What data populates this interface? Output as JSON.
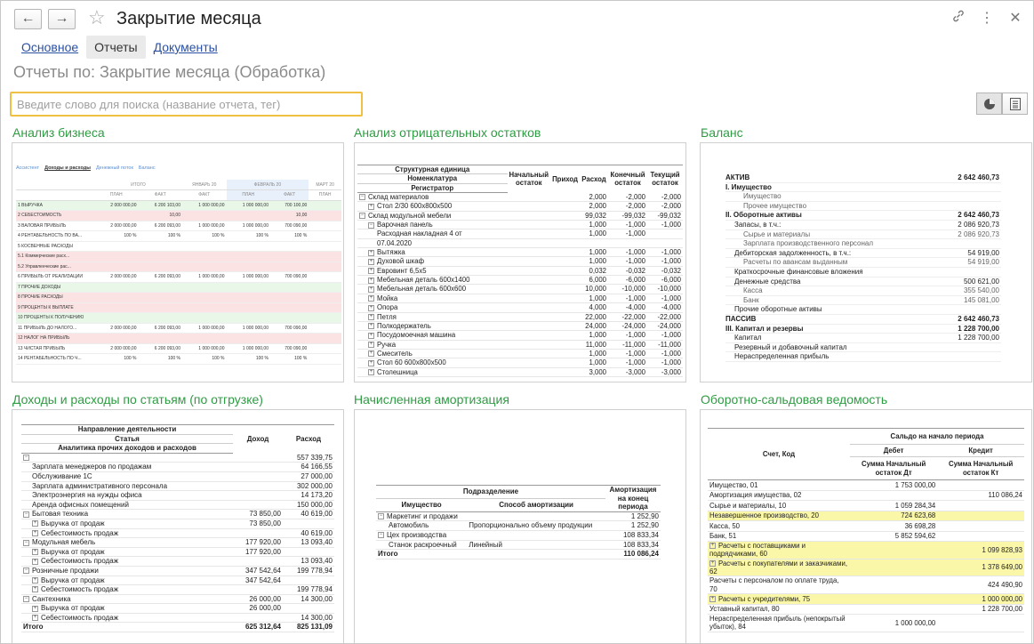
{
  "window": {
    "title": "Закрытие месяца",
    "back_glyph": "←",
    "forward_glyph": "→"
  },
  "tabs": [
    {
      "label": "Основное"
    },
    {
      "label": "Отчеты"
    },
    {
      "label": "Документы"
    }
  ],
  "page_title": "Отчеты по: Закрытие месяца (Обработка)",
  "search": {
    "placeholder": "Введите слово для поиска (название отчета, тег)"
  },
  "cards": [
    {
      "title": "Анализ бизнеса"
    },
    {
      "title": "Анализ отрицательных остатков"
    },
    {
      "title": "Баланс"
    },
    {
      "title": "Доходы и расходы по статьям (по отгрузке)"
    },
    {
      "title": "Начисленная амортизация"
    },
    {
      "title": "Оборотно-сальдовая ведомость"
    }
  ],
  "business": {
    "nav": [
      "Ассистент",
      "Доходы и расходы",
      "Денежный поток",
      "Баланс"
    ],
    "header_periods": [
      "ИТОГО",
      "ЯНВАРЬ 20",
      "ФЕВРАЛЬ 20",
      "МАРТ 20"
    ],
    "header_cols": [
      "ПЛАН",
      "ФАКТ",
      "ФАКТ",
      "ПЛАН",
      "ФАКТ",
      "ПЛАН"
    ],
    "rows": [
      {
        "label": "1  ВЫРУЧКА",
        "vals": [
          "2 000 000,00",
          "6 200 103,00",
          "1 000 000,00",
          "1 000 000,00",
          "700 100,00",
          ""
        ],
        "style": "grn"
      },
      {
        "label": "2  СЕБЕСТОИМОСТЬ",
        "vals": [
          "",
          "10,00",
          "",
          "",
          "10,00",
          ""
        ],
        "style": "red"
      },
      {
        "label": "3  ВАЛОВАЯ ПРИБЫЛЬ",
        "vals": [
          "2 000 000,00",
          "6 200 093,00",
          "1 000 000,00",
          "1 000 000,00",
          "700 090,00",
          ""
        ],
        "style": ""
      },
      {
        "label": "4  РЕНТАБЕЛЬНОСТЬ ПО ВА...",
        "vals": [
          "100 %",
          "100 %",
          "100 %",
          "100 %",
          "100 %",
          ""
        ],
        "style": ""
      },
      {
        "label": "5  КОСВЕННЫЕ РАСХОДЫ",
        "vals": [
          "",
          "",
          "",
          "",
          "",
          ""
        ],
        "style": ""
      },
      {
        "label": "5.1  Коммерческие расх...",
        "vals": [
          "",
          "",
          "",
          "",
          "",
          ""
        ],
        "style": "red"
      },
      {
        "label": "5.2  Управленческие рас...",
        "vals": [
          "",
          "",
          "",
          "",
          "",
          ""
        ],
        "style": "red"
      },
      {
        "label": "6  ПРИБЫЛЬ ОТ РЕАЛИЗАЦИИ",
        "vals": [
          "2 000 000,00",
          "6 200 093,00",
          "1 000 000,00",
          "1 000 000,00",
          "700 090,00",
          ""
        ],
        "style": ""
      },
      {
        "label": "7  ПРОЧИЕ ДОХОДЫ",
        "vals": [
          "",
          "",
          "",
          "",
          "",
          ""
        ],
        "style": "grn"
      },
      {
        "label": "8  ПРОЧИЕ РАСХОДЫ",
        "vals": [
          "",
          "",
          "",
          "",
          "",
          ""
        ],
        "style": "red"
      },
      {
        "label": "9  ПРОЦЕНТЫ К ВЫПЛАТЕ",
        "vals": [
          "",
          "",
          "",
          "",
          "",
          ""
        ],
        "style": "red"
      },
      {
        "label": "10  ПРОЦЕНТЫ К ПОЛУЧЕНИЮ",
        "vals": [
          "",
          "",
          "",
          "",
          "",
          ""
        ],
        "style": "grn"
      },
      {
        "label": "11  ПРИБЫЛЬ ДО НАЛОГО...",
        "vals": [
          "2 000 000,00",
          "6 200 093,00",
          "1 000 000,00",
          "1 000 000,00",
          "700 090,00",
          ""
        ],
        "style": ""
      },
      {
        "label": "12  НАЛОГ НА ПРИБЫЛЬ",
        "vals": [
          "",
          "",
          "",
          "",
          "",
          ""
        ],
        "style": "red"
      },
      {
        "label": "13  ЧИСТАЯ ПРИБЫЛЬ",
        "vals": [
          "2 000 000,00",
          "6 200 093,00",
          "1 000 000,00",
          "1 000 000,00",
          "700 090,00",
          ""
        ],
        "style": ""
      },
      {
        "label": "14  РЕНТАБЕЛЬНОСТЬ ПО Ч...",
        "vals": [
          "100 %",
          "100 %",
          "100 %",
          "100 %",
          "100 %",
          ""
        ],
        "style": ""
      }
    ]
  },
  "negative": {
    "headers": [
      "Структурная единица",
      "Номенклатура",
      "Регистратор",
      "Начальный остаток",
      "Приход",
      "Расход",
      "Конечный остаток",
      "Текущий остаток"
    ],
    "rows": [
      {
        "name": "Склад материалов",
        "lvl": 0,
        "tree": "−",
        "vals": [
          "",
          "",
          "2,000",
          "-2,000",
          "-2,000"
        ]
      },
      {
        "name": "Стол 2/30 600х800х500",
        "lvl": 1,
        "tree": "+",
        "vals": [
          "",
          "",
          "2,000",
          "-2,000",
          "-2,000"
        ]
      },
      {
        "name": "Склад модульной мебели",
        "lvl": 0,
        "tree": "−",
        "vals": [
          "",
          "",
          "99,032",
          "-99,032",
          "-99,032"
        ]
      },
      {
        "name": "Варочная панель",
        "lvl": 1,
        "tree": "−",
        "vals": [
          "",
          "",
          "1,000",
          "-1,000",
          "-1,000"
        ]
      },
      {
        "name": "Расходная накладная 4 от",
        "lvl": 2,
        "tree": "",
        "vals": [
          "",
          "",
          "1,000",
          "-1,000",
          ""
        ]
      },
      {
        "name": "07.04.2020",
        "lvl": 2,
        "tree": "",
        "vals": [
          "",
          "",
          "",
          "",
          ""
        ]
      },
      {
        "name": "Вытяжка",
        "lvl": 1,
        "tree": "+",
        "vals": [
          "",
          "",
          "1,000",
          "-1,000",
          "-1,000"
        ]
      },
      {
        "name": "Духовой шкаф",
        "lvl": 1,
        "tree": "+",
        "vals": [
          "",
          "",
          "1,000",
          "-1,000",
          "-1,000"
        ]
      },
      {
        "name": "Евровинт 6,5х5",
        "lvl": 1,
        "tree": "+",
        "vals": [
          "",
          "",
          "0,032",
          "-0,032",
          "-0,032"
        ]
      },
      {
        "name": "Мебельная деталь 600х1400",
        "lvl": 1,
        "tree": "+",
        "vals": [
          "",
          "",
          "6,000",
          "-6,000",
          "-6,000"
        ]
      },
      {
        "name": "Мебельная деталь 600х600",
        "lvl": 1,
        "tree": "+",
        "vals": [
          "",
          "",
          "10,000",
          "-10,000",
          "-10,000"
        ]
      },
      {
        "name": "Мойка",
        "lvl": 1,
        "tree": "+",
        "vals": [
          "",
          "",
          "1,000",
          "-1,000",
          "-1,000"
        ]
      },
      {
        "name": "Опора",
        "lvl": 1,
        "tree": "+",
        "vals": [
          "",
          "",
          "4,000",
          "-4,000",
          "-4,000"
        ]
      },
      {
        "name": "Петля",
        "lvl": 1,
        "tree": "+",
        "vals": [
          "",
          "",
          "22,000",
          "-22,000",
          "-22,000"
        ]
      },
      {
        "name": "Полкодержатель",
        "lvl": 1,
        "tree": "+",
        "vals": [
          "",
          "",
          "24,000",
          "-24,000",
          "-24,000"
        ]
      },
      {
        "name": "Посудомоечная машина",
        "lvl": 1,
        "tree": "+",
        "vals": [
          "",
          "",
          "1,000",
          "-1,000",
          "-1,000"
        ]
      },
      {
        "name": "Ручка",
        "lvl": 1,
        "tree": "+",
        "vals": [
          "",
          "",
          "11,000",
          "-11,000",
          "-11,000"
        ]
      },
      {
        "name": "Смеситель",
        "lvl": 1,
        "tree": "+",
        "vals": [
          "",
          "",
          "1,000",
          "-1,000",
          "-1,000"
        ]
      },
      {
        "name": "Стол 60 600х800х500",
        "lvl": 1,
        "tree": "+",
        "vals": [
          "",
          "",
          "1,000",
          "-1,000",
          "-1,000"
        ]
      },
      {
        "name": "Столешница",
        "lvl": 1,
        "tree": "+",
        "vals": [
          "",
          "",
          "3,000",
          "-3,000",
          "-3,000"
        ]
      }
    ]
  },
  "balance": {
    "rows": [
      {
        "label": "АКТИВ",
        "val": "2 642 460,73",
        "lvl": 0,
        "bold": true
      },
      {
        "label": "I. Имущество",
        "val": "",
        "lvl": 0,
        "bold": true
      },
      {
        "label": "Имущество",
        "val": "",
        "lvl": 2,
        "bold": false
      },
      {
        "label": "Прочее имущество",
        "val": "",
        "lvl": 2,
        "bold": false
      },
      {
        "label": "II. Оборотные активы",
        "val": "2 642 460,73",
        "lvl": 0,
        "bold": true
      },
      {
        "label": "Запасы, в т.ч.:",
        "val": "2 086 920,73",
        "lvl": 1,
        "bold": false
      },
      {
        "label": "Сырье и материалы",
        "val": "2 086 920,73",
        "lvl": 2,
        "bold": false
      },
      {
        "label": "Зарплата производственного персонал",
        "val": "",
        "lvl": 2,
        "bold": false
      },
      {
        "label": "Дебиторская задолженность, в т.ч.:",
        "val": "54 919,00",
        "lvl": 1,
        "bold": false
      },
      {
        "label": "Расчеты по авансам выданным",
        "val": "54 919,00",
        "lvl": 2,
        "bold": false
      },
      {
        "label": "Краткосрочные финансовые вложения",
        "val": "",
        "lvl": 1,
        "bold": false
      },
      {
        "label": "Денежные средства",
        "val": "500 621,00",
        "lvl": 1,
        "bold": false
      },
      {
        "label": "Касса",
        "val": "355 540,00",
        "lvl": 2,
        "bold": false
      },
      {
        "label": "Банк",
        "val": "145 081,00",
        "lvl": 2,
        "bold": false
      },
      {
        "label": "Прочие оборотные активы",
        "val": "",
        "lvl": 1,
        "bold": false
      },
      {
        "label": "ПАССИВ",
        "val": "2 642 460,73",
        "lvl": 0,
        "bold": true
      },
      {
        "label": "III. Капитал и резервы",
        "val": "1 228 700,00",
        "lvl": 0,
        "bold": true
      },
      {
        "label": "Капитал",
        "val": "1 228 700,00",
        "lvl": 1,
        "bold": false
      },
      {
        "label": "Резервный и добавочный капитал",
        "val": "",
        "lvl": 1,
        "bold": false
      },
      {
        "label": "Нераспределенная прибыль",
        "val": "",
        "lvl": 1,
        "bold": false
      }
    ]
  },
  "income": {
    "headers": [
      "Направление деятельности",
      "Статья",
      "Аналитика прочих доходов и расходов",
      "Доход",
      "Расход"
    ],
    "rows": [
      {
        "label": "",
        "d": "",
        "r": "557 339,75",
        "lvl": 0,
        "tree": "−",
        "bold": false
      },
      {
        "label": "Зарплата менеджеров по продажам",
        "d": "",
        "r": "64 166,55",
        "lvl": 1,
        "tree": "",
        "bold": false
      },
      {
        "label": "Обслуживание 1С",
        "d": "",
        "r": "27 000,00",
        "lvl": 1,
        "tree": "",
        "bold": false
      },
      {
        "label": "Зарплата административного персонала",
        "d": "",
        "r": "302 000,00",
        "lvl": 1,
        "tree": "",
        "bold": false
      },
      {
        "label": "Электроэнергия на нужды офиса",
        "d": "",
        "r": "14 173,20",
        "lvl": 1,
        "tree": "",
        "bold": false
      },
      {
        "label": "Аренда офисных помещений",
        "d": "",
        "r": "150 000,00",
        "lvl": 1,
        "tree": "",
        "bold": false
      },
      {
        "label": "Бытовая техника",
        "d": "73 850,00",
        "r": "40 619,00",
        "lvl": 0,
        "tree": "−",
        "bold": false
      },
      {
        "label": "Выручка от продаж",
        "d": "73 850,00",
        "r": "",
        "lvl": 1,
        "tree": "+",
        "bold": false
      },
      {
        "label": "Себестоимость продаж",
        "d": "",
        "r": "40 619,00",
        "lvl": 1,
        "tree": "+",
        "bold": false
      },
      {
        "label": "Модульная мебель",
        "d": "177 920,00",
        "r": "13 093,40",
        "lvl": 0,
        "tree": "−",
        "bold": false
      },
      {
        "label": "Выручка от продаж",
        "d": "177 920,00",
        "r": "",
        "lvl": 1,
        "tree": "+",
        "bold": false
      },
      {
        "label": "Себестоимость продаж",
        "d": "",
        "r": "13 093,40",
        "lvl": 1,
        "tree": "+",
        "bold": false
      },
      {
        "label": "Розничные продажи",
        "d": "347 542,64",
        "r": "199 778,94",
        "lvl": 0,
        "tree": "−",
        "bold": false
      },
      {
        "label": "Выручка от продаж",
        "d": "347 542,64",
        "r": "",
        "lvl": 1,
        "tree": "+",
        "bold": false
      },
      {
        "label": "Себестоимость продаж",
        "d": "",
        "r": "199 778,94",
        "lvl": 1,
        "tree": "+",
        "bold": false
      },
      {
        "label": "Сантехника",
        "d": "26 000,00",
        "r": "14 300,00",
        "lvl": 0,
        "tree": "−",
        "bold": false
      },
      {
        "label": "Выручка от продаж",
        "d": "26 000,00",
        "r": "",
        "lvl": 1,
        "tree": "+",
        "bold": false
      },
      {
        "label": "Себестоимость продаж",
        "d": "",
        "r": "14 300,00",
        "lvl": 1,
        "tree": "+",
        "bold": false
      },
      {
        "label": "Итого",
        "d": "625 312,64",
        "r": "825 131,09",
        "lvl": 0,
        "tree": "",
        "bold": true
      }
    ]
  },
  "amort": {
    "headers": [
      "Подразделение",
      "Имущество",
      "Способ амортизации",
      "Амортизация на конец периода"
    ],
    "rows": [
      {
        "label": "Маркетинг и продажи",
        "m": "",
        "v": "1 252,90",
        "lvl": 0,
        "tree": "−",
        "bold": false
      },
      {
        "label": "Автомобиль",
        "m": "Пропорционально объему продукции",
        "v": "1 252,90",
        "lvl": 1,
        "tree": "",
        "bold": false
      },
      {
        "label": "Цех производства",
        "m": "",
        "v": "108 833,34",
        "lvl": 0,
        "tree": "−",
        "bold": false
      },
      {
        "label": "Станок раскроечный",
        "m": "Линейный",
        "v": "108 833,34",
        "lvl": 1,
        "tree": "",
        "bold": false
      },
      {
        "label": "Итого",
        "m": "",
        "v": "110 086,24",
        "lvl": 0,
        "tree": "",
        "bold": true
      }
    ]
  },
  "osv": {
    "headers": [
      "Счет, Код",
      "Сальдо на начало периода",
      "Дебет",
      "Кредит",
      "Сумма Начальный остаток Дт",
      "Сумма Начальный остаток Кт"
    ],
    "rows": [
      {
        "label": "Имущество, 01",
        "d": "1 753 000,00",
        "k": "",
        "hl": false,
        "tree": ""
      },
      {
        "label": "Амортизация имущества, 02",
        "d": "",
        "k": "110 086,24",
        "hl": false,
        "tree": ""
      },
      {
        "label": "Сырье и материалы, 10",
        "d": "1 059 284,34",
        "k": "",
        "hl": false,
        "tree": ""
      },
      {
        "label": "Незавершенное производство, 20",
        "d": "724 623,68",
        "k": "",
        "hl": true,
        "tree": ""
      },
      {
        "label": "Касса, 50",
        "d": "36 698,28",
        "k": "",
        "hl": false,
        "tree": ""
      },
      {
        "label": "Банк, 51",
        "d": "5 852 594,62",
        "k": "",
        "hl": false,
        "tree": ""
      },
      {
        "label": "Расчеты с поставщиками и подрядчиками, 60",
        "d": "",
        "k": "1 099 828,93",
        "hl": true,
        "tree": "+"
      },
      {
        "label": "Расчеты с покупателями и заказчиками, 62",
        "d": "",
        "k": "1 378 649,00",
        "hl": true,
        "tree": "+"
      },
      {
        "label": "Расчеты с персоналом по оплате труда, 70",
        "d": "",
        "k": "424 490,90",
        "hl": false,
        "tree": ""
      },
      {
        "label": "Расчеты с учредителями, 75",
        "d": "",
        "k": "1 000 000,00",
        "hl": true,
        "tree": "+"
      },
      {
        "label": "Уставный капитал, 80",
        "d": "",
        "k": "1 228 700,00",
        "hl": false,
        "tree": ""
      },
      {
        "label": "Нераспределенная прибыль (непокрытый убыток), 84",
        "d": "1 000 000,00",
        "k": "",
        "hl": false,
        "tree": ""
      }
    ]
  }
}
